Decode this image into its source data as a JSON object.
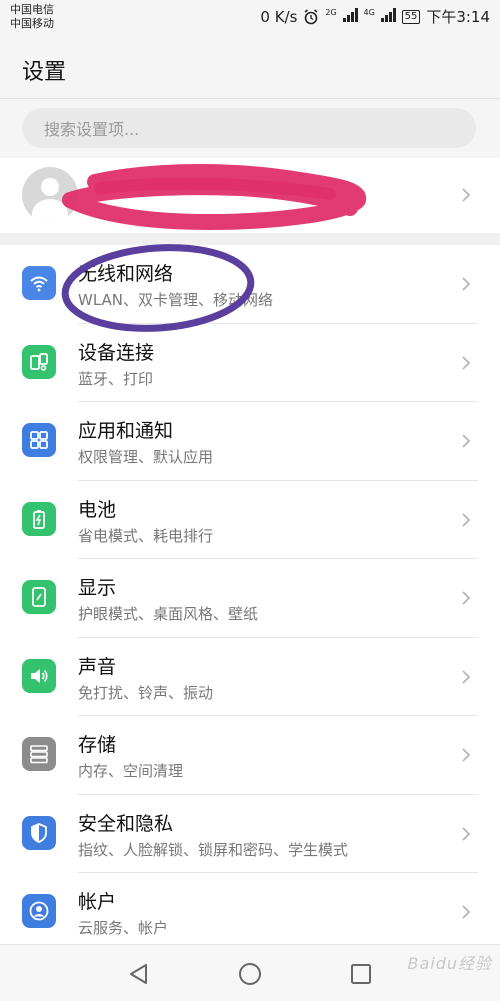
{
  "status_bar": {
    "carrier_1": "中国电信",
    "carrier_2": "中国移动",
    "net_speed": "0 K/s",
    "net_tag_1": "2G",
    "net_tag_2": "4G",
    "battery": "55",
    "time": "下午3:14"
  },
  "header": {
    "title": "设置"
  },
  "search": {
    "placeholder": "搜索设置项..."
  },
  "account": {
    "name": "",
    "subtitle": ""
  },
  "settings": [
    {
      "title": "无线和网络",
      "subtitle": "WLAN、双卡管理、移动网络",
      "icon": "wifi-icon",
      "color": "#4a86e8"
    },
    {
      "title": "设备连接",
      "subtitle": "蓝牙、打印",
      "icon": "device-connect-icon",
      "color": "#34c26e"
    },
    {
      "title": "应用和通知",
      "subtitle": "权限管理、默认应用",
      "icon": "apps-icon",
      "color": "#3f7de0"
    },
    {
      "title": "电池",
      "subtitle": "省电模式、耗电排行",
      "icon": "battery-icon",
      "color": "#34c26e"
    },
    {
      "title": "显示",
      "subtitle": "护眼模式、桌面风格、壁纸",
      "icon": "display-icon",
      "color": "#34c26e"
    },
    {
      "title": "声音",
      "subtitle": "免打扰、铃声、振动",
      "icon": "sound-icon",
      "color": "#34c26e"
    },
    {
      "title": "存储",
      "subtitle": "内存、空间清理",
      "icon": "storage-icon",
      "color": "#8c8c8c"
    },
    {
      "title": "安全和隐私",
      "subtitle": "指纹、人脸解锁、锁屏和密码、学生模式",
      "icon": "security-shield-icon",
      "color": "#3f7de0"
    },
    {
      "title": "帐户",
      "subtitle": "云服务、帐户",
      "icon": "account-icon",
      "color": "#3f7de0"
    }
  ],
  "watermark": "Baidu经验"
}
